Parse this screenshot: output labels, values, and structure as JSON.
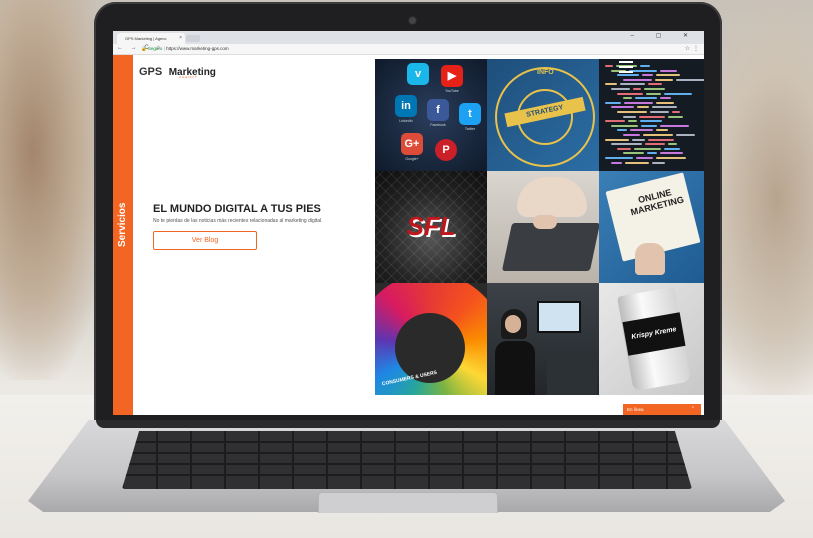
{
  "browser": {
    "tab_title": "GPS Marketing | Agenc",
    "tab_close": "×",
    "window_buttons": "–  ▢  ✕",
    "nav_buttons": "← → C ⌂",
    "secure_label": "Seguro",
    "url": "https://www.marketing-gps.com"
  },
  "site": {
    "logo_prefix": "GPS",
    "logo_name": "Marketing",
    "logo_subtitle": "AGENCY",
    "side_label": "Servicios",
    "hero_title": "EL MUNDO DIGITAL A TUS PIES",
    "hero_subtitle": "No te pierdas de las noticias más recientes relacionadas al marketing digital.",
    "blog_button": "Ver Blog",
    "chat_label": "En línea",
    "chat_caret": "⌃"
  },
  "tiles": {
    "strategy_label": "STRATEGY",
    "info_label": "INFO",
    "sfl_label": "SFL",
    "online_label": "ONLINE MARKETING",
    "wheel_label": "CONSUMERS & USERS",
    "cup_label": "Krispy Kreme",
    "apps": [
      {
        "name": "vimeo",
        "glyph": "v",
        "label": "",
        "color": "#1ab7ea"
      },
      {
        "name": "youtube",
        "glyph": "▶",
        "label": "YouTube",
        "color": "#e62117"
      },
      {
        "name": "linkedin",
        "glyph": "in",
        "label": "LinkedIn",
        "color": "#0077b5"
      },
      {
        "name": "facebook",
        "glyph": "f",
        "label": "Facebook",
        "color": "#3b5998"
      },
      {
        "name": "twitter",
        "glyph": "t",
        "label": "Twitter",
        "color": "#1da1f2"
      },
      {
        "name": "google-plus",
        "glyph": "G+",
        "label": "Google+",
        "color": "#dd4b39"
      },
      {
        "name": "pinterest",
        "glyph": "P",
        "label": "",
        "color": "#cb2027"
      }
    ]
  },
  "colors": {
    "brand_orange": "#f26522"
  }
}
